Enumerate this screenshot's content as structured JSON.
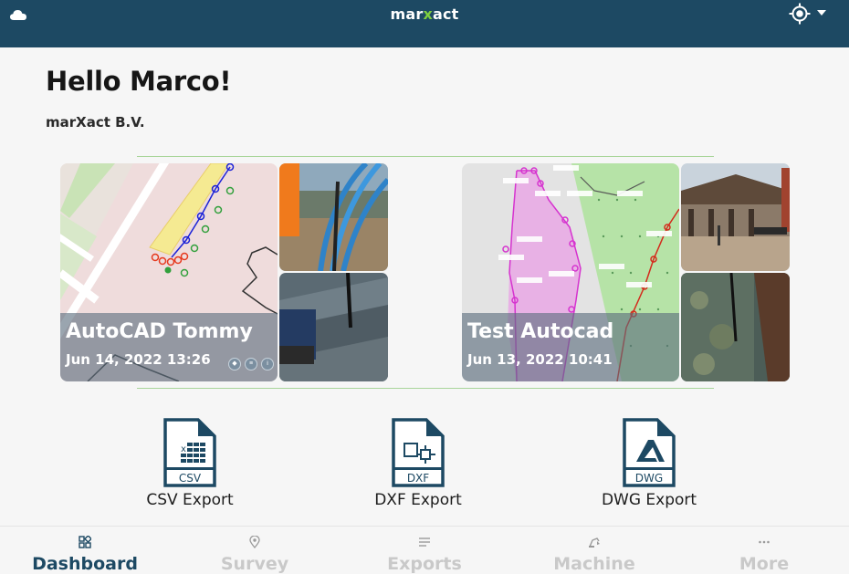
{
  "app": {
    "brand_pre": "mar",
    "brand_x": "x",
    "brand_post": "act"
  },
  "greeting": "Hello Marco!",
  "company": "marXact B.V.",
  "projects": [
    {
      "title": "AutoCAD Tommy",
      "date": "Jun 14, 2022 13:26"
    },
    {
      "title": "Test Autocad",
      "date": "Jun 13, 2022 10:41"
    }
  ],
  "exports": [
    {
      "label": "CSV Export",
      "badge": "CSV"
    },
    {
      "label": "DXF Export",
      "badge": "DXF"
    },
    {
      "label": "DWG Export",
      "badge": "DWG"
    }
  ],
  "nav": [
    {
      "label": "Dashboard",
      "active": true
    },
    {
      "label": "Survey",
      "active": false
    },
    {
      "label": "Exports",
      "active": false
    },
    {
      "label": "Machine",
      "active": false
    },
    {
      "label": "More",
      "active": false
    }
  ],
  "colors": {
    "header": "#1d4963",
    "accent": "#7fcf3f",
    "nav_active": "#1d4963",
    "nav_inactive": "#c9c9c9"
  },
  "icons": [
    "cloud-icon",
    "gps-icon",
    "chevron-down-icon",
    "csv-file-icon",
    "dxf-file-icon",
    "dwg-file-icon",
    "dashboard-icon",
    "location-pin-icon",
    "list-icon",
    "machine-icon",
    "more-dots-icon"
  ]
}
